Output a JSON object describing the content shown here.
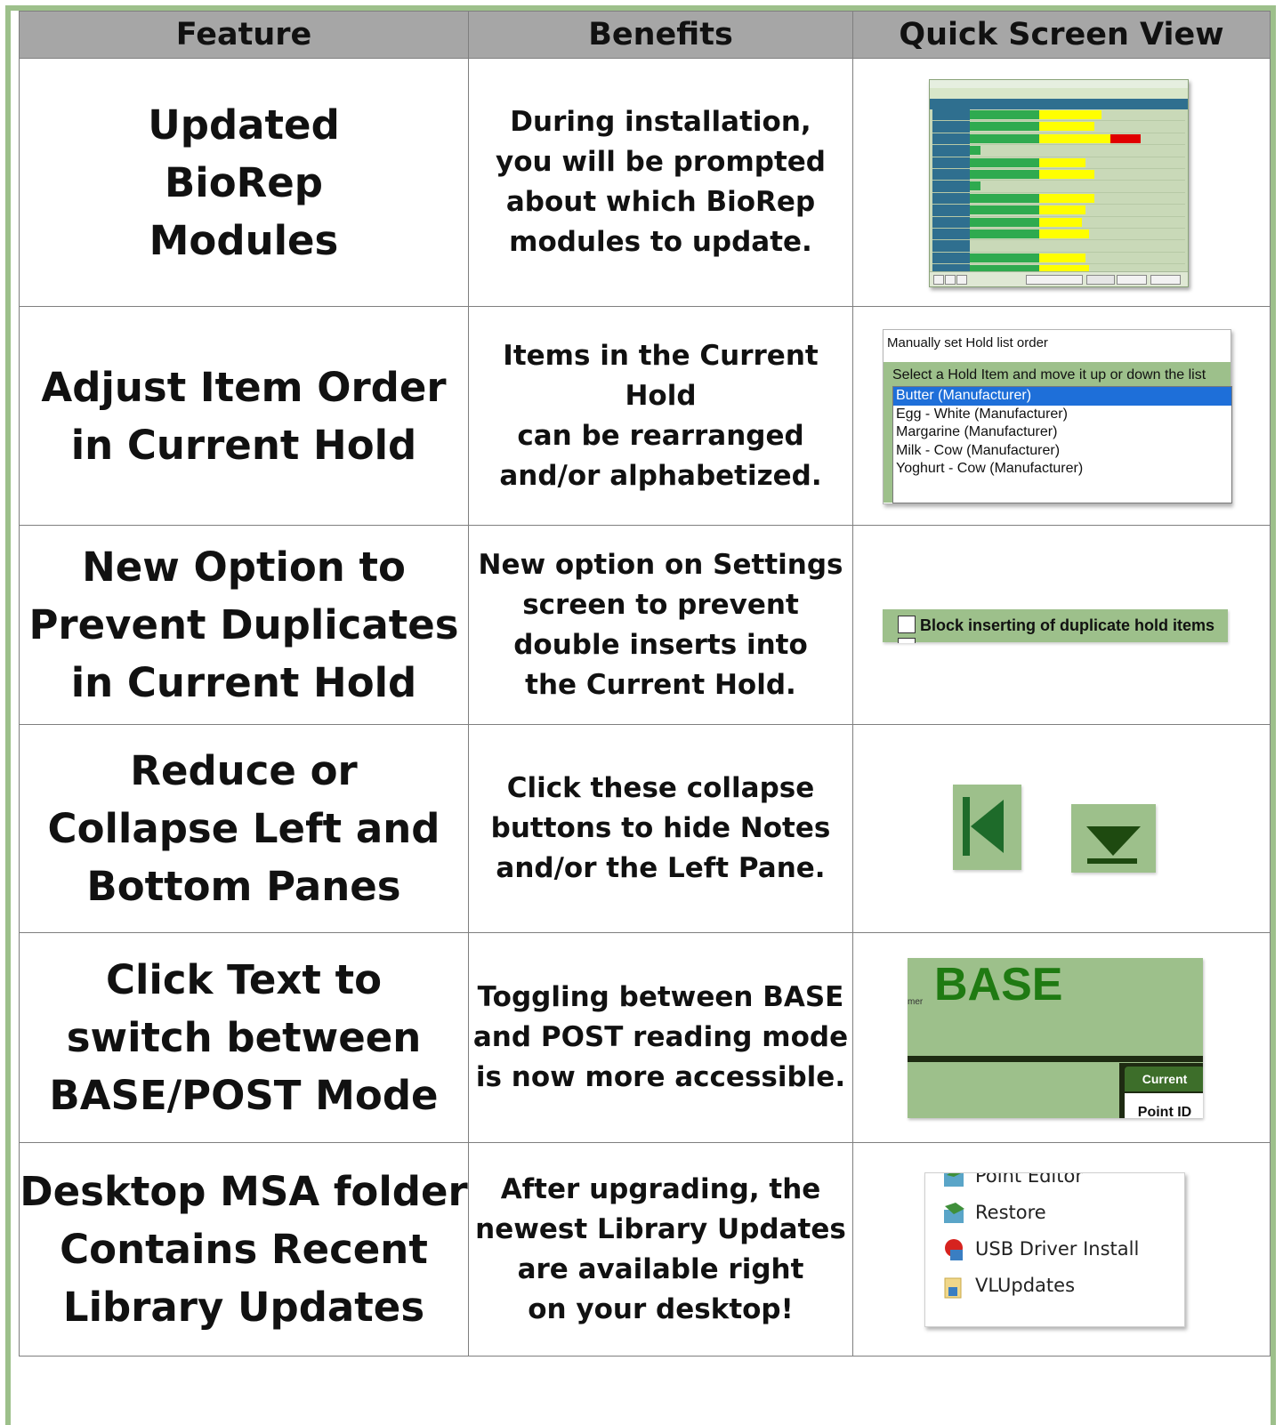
{
  "table": {
    "headers": [
      "Feature",
      "Benefits",
      "Quick Screen View"
    ],
    "rows": [
      {
        "feature": [
          "Updated",
          "BioRep",
          "Modules"
        ],
        "benefit": [
          "During installation,",
          "you will be prompted",
          "about which BioRep",
          "modules to update."
        ],
        "screen": "biorep-modules-screenshot"
      },
      {
        "feature": [
          "Adjust Item Order",
          "in Current Hold"
        ],
        "benefit": [
          "Items in the Current Hold",
          "can be rearranged",
          "and/or alphabetized."
        ],
        "screen": "hold-list-order"
      },
      {
        "feature": [
          "New Option to",
          "Prevent Duplicates",
          "in Current Hold"
        ],
        "benefit": [
          "New option on Settings",
          "screen to prevent",
          "double inserts into",
          "the Current Hold."
        ],
        "screen": "duplicate-option"
      },
      {
        "feature": [
          "Reduce or",
          "Collapse Left and",
          "Bottom Panes"
        ],
        "benefit": [
          "Click these collapse",
          "buttons to hide Notes",
          "and/or the Left Pane."
        ],
        "screen": "collapse-buttons"
      },
      {
        "feature": [
          "Click Text to",
          "switch between",
          "BASE/POST Mode"
        ],
        "benefit": [
          "Toggling between BASE",
          "and POST reading mode",
          "is now more accessible."
        ],
        "screen": "base-post-toggle"
      },
      {
        "feature": [
          "Desktop MSA folder",
          "Contains Recent",
          "Library Updates"
        ],
        "benefit": [
          "After upgrading, the",
          "newest Library Updates",
          "are available right",
          "on your desktop!"
        ],
        "screen": "msa-folder"
      }
    ]
  },
  "hold_dialog": {
    "title": "Manually set Hold list order",
    "prompt": "Select a Hold Item and move it up  or down the list",
    "items": [
      "Butter (Manufacturer)",
      "Egg - White (Manufacturer)",
      "Margarine (Manufacturer)",
      "Milk - Cow (Manufacturer)",
      "Yoghurt - Cow (Manufacturer)"
    ],
    "selected_index": 0
  },
  "duplicate_option": {
    "label": "Block inserting of duplicate hold items",
    "checked": false
  },
  "collapse_buttons": {
    "left_icon": "collapse-left-icon",
    "bottom_icon": "collapse-bottom-icon"
  },
  "base_toggle": {
    "mode": "BASE",
    "partial_left": "mer",
    "tab": "Current",
    "column": "Point ID"
  },
  "msa_folder": {
    "items": [
      {
        "label": "Point Editor",
        "icon": "app-icon"
      },
      {
        "label": "Restore",
        "icon": "app-icon"
      },
      {
        "label": "USB Driver Install",
        "icon": "installer-icon"
      },
      {
        "label": "VLUpdates",
        "icon": "folder-icon"
      }
    ]
  },
  "colors": {
    "frame": "#9dc08b",
    "header": "#a6a6a6",
    "accent_green": "#1f7a12",
    "selection": "#1e6fd9"
  }
}
